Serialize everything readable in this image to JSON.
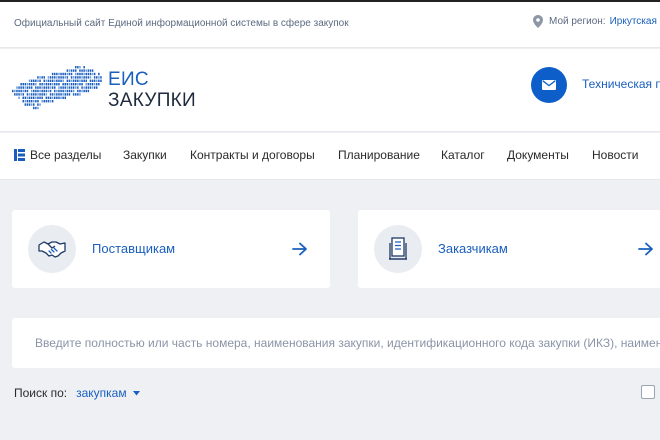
{
  "topbar": {
    "site_caption": "Официальный сайт Единой информационной системы в сфере закупок",
    "region_label": "Мой регион:",
    "region_value": "Иркутская"
  },
  "header": {
    "logo_line1": "ЕИС",
    "logo_line2": "ЗАКУПКИ",
    "support_label": "Техническая п",
    "icons": [
      "russia-map-logo",
      "mail-icon"
    ]
  },
  "nav": {
    "items": [
      "Все разделы",
      "Закупки",
      "Контракты и договоры",
      "Планирование",
      "Каталог",
      "Документы",
      "Новости"
    ]
  },
  "cards": [
    {
      "label": "Поставщикам",
      "icon": "handshake-icon"
    },
    {
      "label": "Заказчикам",
      "icon": "document-icon"
    }
  ],
  "search": {
    "placeholder": "Введите полностью или часть номера, наименования закупки, идентификационного кода закупки (ИКЗ), наимено"
  },
  "search_by": {
    "label": "Поиск по:",
    "scope": "закупкам"
  },
  "colors": {
    "accent": "#1a5fbe",
    "button": "#0d5ec8",
    "background": "#eef0f4",
    "text": "#2a2a2a"
  }
}
